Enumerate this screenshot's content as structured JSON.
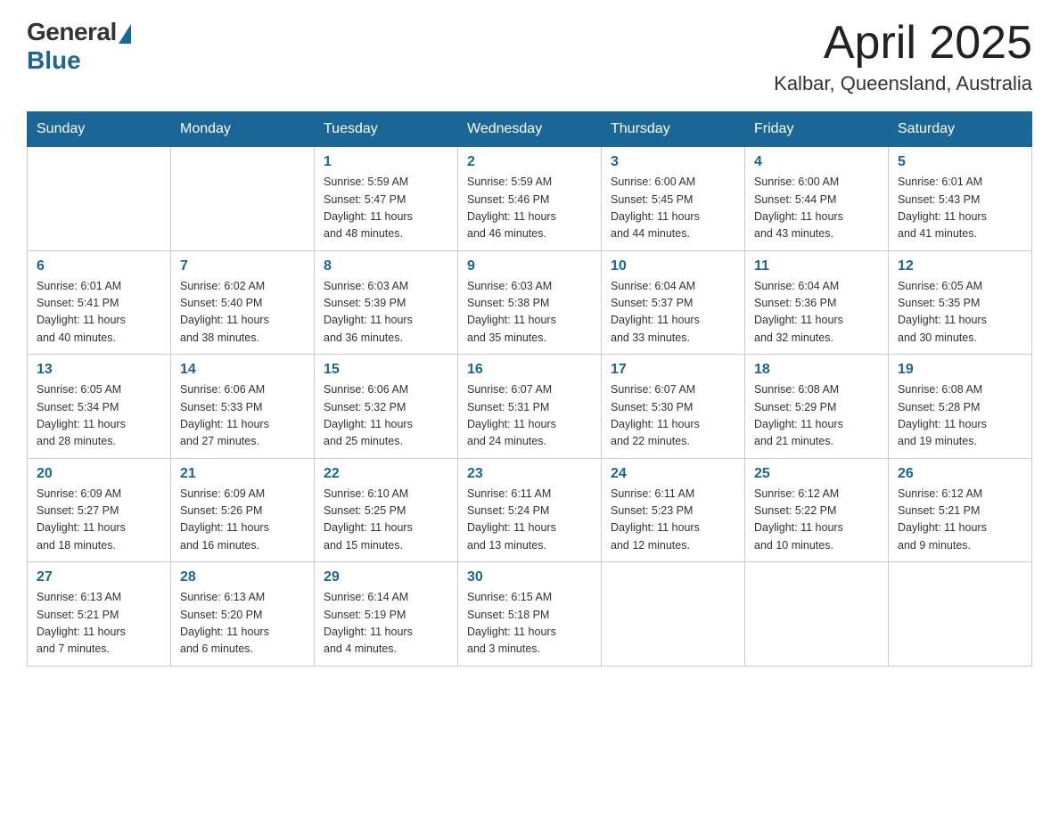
{
  "header": {
    "logo_general": "General",
    "logo_blue": "Blue",
    "month_title": "April 2025",
    "location": "Kalbar, Queensland, Australia"
  },
  "days_of_week": [
    "Sunday",
    "Monday",
    "Tuesday",
    "Wednesday",
    "Thursday",
    "Friday",
    "Saturday"
  ],
  "weeks": [
    [
      {
        "day": "",
        "info": ""
      },
      {
        "day": "",
        "info": ""
      },
      {
        "day": "1",
        "info": "Sunrise: 5:59 AM\nSunset: 5:47 PM\nDaylight: 11 hours\nand 48 minutes."
      },
      {
        "day": "2",
        "info": "Sunrise: 5:59 AM\nSunset: 5:46 PM\nDaylight: 11 hours\nand 46 minutes."
      },
      {
        "day": "3",
        "info": "Sunrise: 6:00 AM\nSunset: 5:45 PM\nDaylight: 11 hours\nand 44 minutes."
      },
      {
        "day": "4",
        "info": "Sunrise: 6:00 AM\nSunset: 5:44 PM\nDaylight: 11 hours\nand 43 minutes."
      },
      {
        "day": "5",
        "info": "Sunrise: 6:01 AM\nSunset: 5:43 PM\nDaylight: 11 hours\nand 41 minutes."
      }
    ],
    [
      {
        "day": "6",
        "info": "Sunrise: 6:01 AM\nSunset: 5:41 PM\nDaylight: 11 hours\nand 40 minutes."
      },
      {
        "day": "7",
        "info": "Sunrise: 6:02 AM\nSunset: 5:40 PM\nDaylight: 11 hours\nand 38 minutes."
      },
      {
        "day": "8",
        "info": "Sunrise: 6:03 AM\nSunset: 5:39 PM\nDaylight: 11 hours\nand 36 minutes."
      },
      {
        "day": "9",
        "info": "Sunrise: 6:03 AM\nSunset: 5:38 PM\nDaylight: 11 hours\nand 35 minutes."
      },
      {
        "day": "10",
        "info": "Sunrise: 6:04 AM\nSunset: 5:37 PM\nDaylight: 11 hours\nand 33 minutes."
      },
      {
        "day": "11",
        "info": "Sunrise: 6:04 AM\nSunset: 5:36 PM\nDaylight: 11 hours\nand 32 minutes."
      },
      {
        "day": "12",
        "info": "Sunrise: 6:05 AM\nSunset: 5:35 PM\nDaylight: 11 hours\nand 30 minutes."
      }
    ],
    [
      {
        "day": "13",
        "info": "Sunrise: 6:05 AM\nSunset: 5:34 PM\nDaylight: 11 hours\nand 28 minutes."
      },
      {
        "day": "14",
        "info": "Sunrise: 6:06 AM\nSunset: 5:33 PM\nDaylight: 11 hours\nand 27 minutes."
      },
      {
        "day": "15",
        "info": "Sunrise: 6:06 AM\nSunset: 5:32 PM\nDaylight: 11 hours\nand 25 minutes."
      },
      {
        "day": "16",
        "info": "Sunrise: 6:07 AM\nSunset: 5:31 PM\nDaylight: 11 hours\nand 24 minutes."
      },
      {
        "day": "17",
        "info": "Sunrise: 6:07 AM\nSunset: 5:30 PM\nDaylight: 11 hours\nand 22 minutes."
      },
      {
        "day": "18",
        "info": "Sunrise: 6:08 AM\nSunset: 5:29 PM\nDaylight: 11 hours\nand 21 minutes."
      },
      {
        "day": "19",
        "info": "Sunrise: 6:08 AM\nSunset: 5:28 PM\nDaylight: 11 hours\nand 19 minutes."
      }
    ],
    [
      {
        "day": "20",
        "info": "Sunrise: 6:09 AM\nSunset: 5:27 PM\nDaylight: 11 hours\nand 18 minutes."
      },
      {
        "day": "21",
        "info": "Sunrise: 6:09 AM\nSunset: 5:26 PM\nDaylight: 11 hours\nand 16 minutes."
      },
      {
        "day": "22",
        "info": "Sunrise: 6:10 AM\nSunset: 5:25 PM\nDaylight: 11 hours\nand 15 minutes."
      },
      {
        "day": "23",
        "info": "Sunrise: 6:11 AM\nSunset: 5:24 PM\nDaylight: 11 hours\nand 13 minutes."
      },
      {
        "day": "24",
        "info": "Sunrise: 6:11 AM\nSunset: 5:23 PM\nDaylight: 11 hours\nand 12 minutes."
      },
      {
        "day": "25",
        "info": "Sunrise: 6:12 AM\nSunset: 5:22 PM\nDaylight: 11 hours\nand 10 minutes."
      },
      {
        "day": "26",
        "info": "Sunrise: 6:12 AM\nSunset: 5:21 PM\nDaylight: 11 hours\nand 9 minutes."
      }
    ],
    [
      {
        "day": "27",
        "info": "Sunrise: 6:13 AM\nSunset: 5:21 PM\nDaylight: 11 hours\nand 7 minutes."
      },
      {
        "day": "28",
        "info": "Sunrise: 6:13 AM\nSunset: 5:20 PM\nDaylight: 11 hours\nand 6 minutes."
      },
      {
        "day": "29",
        "info": "Sunrise: 6:14 AM\nSunset: 5:19 PM\nDaylight: 11 hours\nand 4 minutes."
      },
      {
        "day": "30",
        "info": "Sunrise: 6:15 AM\nSunset: 5:18 PM\nDaylight: 11 hours\nand 3 minutes."
      },
      {
        "day": "",
        "info": ""
      },
      {
        "day": "",
        "info": ""
      },
      {
        "day": "",
        "info": ""
      }
    ]
  ]
}
